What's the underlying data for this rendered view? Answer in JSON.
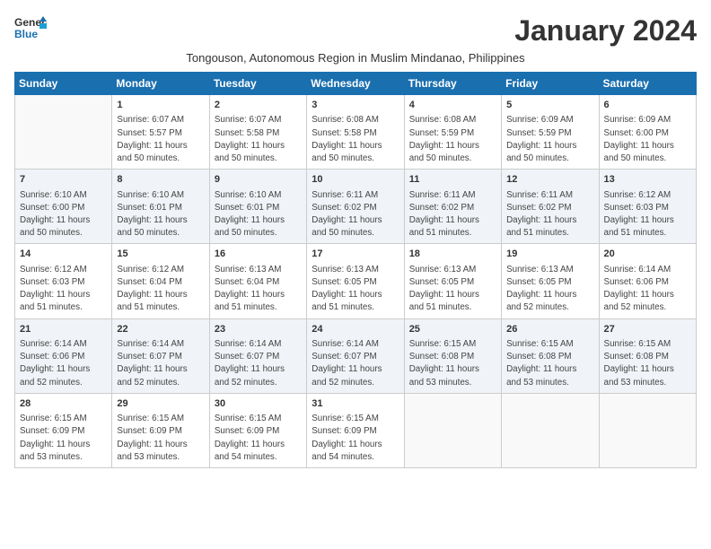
{
  "header": {
    "logo_line1": "General",
    "logo_line2": "Blue",
    "title": "January 2024",
    "subtitle": "Tongouson, Autonomous Region in Muslim Mindanao, Philippines"
  },
  "days_of_week": [
    "Sunday",
    "Monday",
    "Tuesday",
    "Wednesday",
    "Thursday",
    "Friday",
    "Saturday"
  ],
  "weeks": [
    [
      {
        "day": "",
        "info": ""
      },
      {
        "day": "1",
        "info": "Sunrise: 6:07 AM\nSunset: 5:57 PM\nDaylight: 11 hours\nand 50 minutes."
      },
      {
        "day": "2",
        "info": "Sunrise: 6:07 AM\nSunset: 5:58 PM\nDaylight: 11 hours\nand 50 minutes."
      },
      {
        "day": "3",
        "info": "Sunrise: 6:08 AM\nSunset: 5:58 PM\nDaylight: 11 hours\nand 50 minutes."
      },
      {
        "day": "4",
        "info": "Sunrise: 6:08 AM\nSunset: 5:59 PM\nDaylight: 11 hours\nand 50 minutes."
      },
      {
        "day": "5",
        "info": "Sunrise: 6:09 AM\nSunset: 5:59 PM\nDaylight: 11 hours\nand 50 minutes."
      },
      {
        "day": "6",
        "info": "Sunrise: 6:09 AM\nSunset: 6:00 PM\nDaylight: 11 hours\nand 50 minutes."
      }
    ],
    [
      {
        "day": "7",
        "info": "Sunrise: 6:10 AM\nSunset: 6:00 PM\nDaylight: 11 hours\nand 50 minutes."
      },
      {
        "day": "8",
        "info": "Sunrise: 6:10 AM\nSunset: 6:01 PM\nDaylight: 11 hours\nand 50 minutes."
      },
      {
        "day": "9",
        "info": "Sunrise: 6:10 AM\nSunset: 6:01 PM\nDaylight: 11 hours\nand 50 minutes."
      },
      {
        "day": "10",
        "info": "Sunrise: 6:11 AM\nSunset: 6:02 PM\nDaylight: 11 hours\nand 50 minutes."
      },
      {
        "day": "11",
        "info": "Sunrise: 6:11 AM\nSunset: 6:02 PM\nDaylight: 11 hours\nand 51 minutes."
      },
      {
        "day": "12",
        "info": "Sunrise: 6:11 AM\nSunset: 6:02 PM\nDaylight: 11 hours\nand 51 minutes."
      },
      {
        "day": "13",
        "info": "Sunrise: 6:12 AM\nSunset: 6:03 PM\nDaylight: 11 hours\nand 51 minutes."
      }
    ],
    [
      {
        "day": "14",
        "info": "Sunrise: 6:12 AM\nSunset: 6:03 PM\nDaylight: 11 hours\nand 51 minutes."
      },
      {
        "day": "15",
        "info": "Sunrise: 6:12 AM\nSunset: 6:04 PM\nDaylight: 11 hours\nand 51 minutes."
      },
      {
        "day": "16",
        "info": "Sunrise: 6:13 AM\nSunset: 6:04 PM\nDaylight: 11 hours\nand 51 minutes."
      },
      {
        "day": "17",
        "info": "Sunrise: 6:13 AM\nSunset: 6:05 PM\nDaylight: 11 hours\nand 51 minutes."
      },
      {
        "day": "18",
        "info": "Sunrise: 6:13 AM\nSunset: 6:05 PM\nDaylight: 11 hours\nand 51 minutes."
      },
      {
        "day": "19",
        "info": "Sunrise: 6:13 AM\nSunset: 6:05 PM\nDaylight: 11 hours\nand 52 minutes."
      },
      {
        "day": "20",
        "info": "Sunrise: 6:14 AM\nSunset: 6:06 PM\nDaylight: 11 hours\nand 52 minutes."
      }
    ],
    [
      {
        "day": "21",
        "info": "Sunrise: 6:14 AM\nSunset: 6:06 PM\nDaylight: 11 hours\nand 52 minutes."
      },
      {
        "day": "22",
        "info": "Sunrise: 6:14 AM\nSunset: 6:07 PM\nDaylight: 11 hours\nand 52 minutes."
      },
      {
        "day": "23",
        "info": "Sunrise: 6:14 AM\nSunset: 6:07 PM\nDaylight: 11 hours\nand 52 minutes."
      },
      {
        "day": "24",
        "info": "Sunrise: 6:14 AM\nSunset: 6:07 PM\nDaylight: 11 hours\nand 52 minutes."
      },
      {
        "day": "25",
        "info": "Sunrise: 6:15 AM\nSunset: 6:08 PM\nDaylight: 11 hours\nand 53 minutes."
      },
      {
        "day": "26",
        "info": "Sunrise: 6:15 AM\nSunset: 6:08 PM\nDaylight: 11 hours\nand 53 minutes."
      },
      {
        "day": "27",
        "info": "Sunrise: 6:15 AM\nSunset: 6:08 PM\nDaylight: 11 hours\nand 53 minutes."
      }
    ],
    [
      {
        "day": "28",
        "info": "Sunrise: 6:15 AM\nSunset: 6:09 PM\nDaylight: 11 hours\nand 53 minutes."
      },
      {
        "day": "29",
        "info": "Sunrise: 6:15 AM\nSunset: 6:09 PM\nDaylight: 11 hours\nand 53 minutes."
      },
      {
        "day": "30",
        "info": "Sunrise: 6:15 AM\nSunset: 6:09 PM\nDaylight: 11 hours\nand 54 minutes."
      },
      {
        "day": "31",
        "info": "Sunrise: 6:15 AM\nSunset: 6:09 PM\nDaylight: 11 hours\nand 54 minutes."
      },
      {
        "day": "",
        "info": ""
      },
      {
        "day": "",
        "info": ""
      },
      {
        "day": "",
        "info": ""
      }
    ]
  ]
}
